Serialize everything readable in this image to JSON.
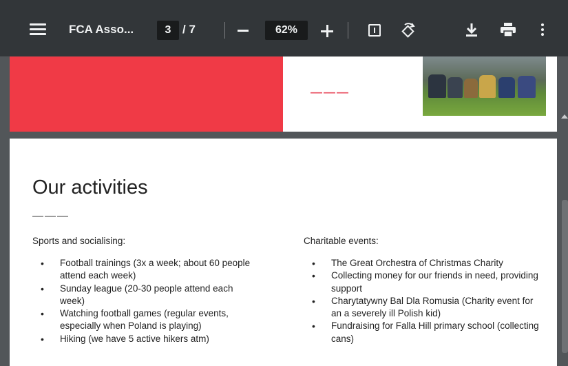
{
  "toolbar": {
    "title": "FCA Asso...",
    "current_page": "3",
    "page_separator": "/ 7",
    "zoom": "62%",
    "icons": [
      "menu-icon",
      "zoom-out-icon",
      "zoom-in-icon",
      "fit-page-icon",
      "rotate-icon",
      "download-icon",
      "print-icon",
      "more-options-icon"
    ]
  },
  "previous_page": {
    "dashes": "———",
    "accent_color": "#f03a46"
  },
  "page": {
    "heading": "Our activities",
    "heading_dash": "———",
    "left_column": {
      "title": "Sports and socialising:",
      "items": [
        "Football trainings (3x a week; about 60 people attend each week)",
        "Sunday league (20-30 people attend each week)",
        "Watching football games (regular events, especially when Poland is playing)",
        "Hiking (we have 5 active hikers atm)"
      ]
    },
    "right_column": {
      "title": "Charitable events:",
      "items": [
        "The Great Orchestra of Christmas Charity",
        "Collecting money for our friends in need, providing support",
        "Charytatywny Bal Dla Romusia (Charity event for an a severely ill Polish kid)",
        "Fundraising for Falla Hill primary school (collecting cans)"
      ]
    }
  },
  "colors": {
    "toolbar_bg": "#323639",
    "viewer_bg": "#525659",
    "accent_red": "#f03a46"
  }
}
